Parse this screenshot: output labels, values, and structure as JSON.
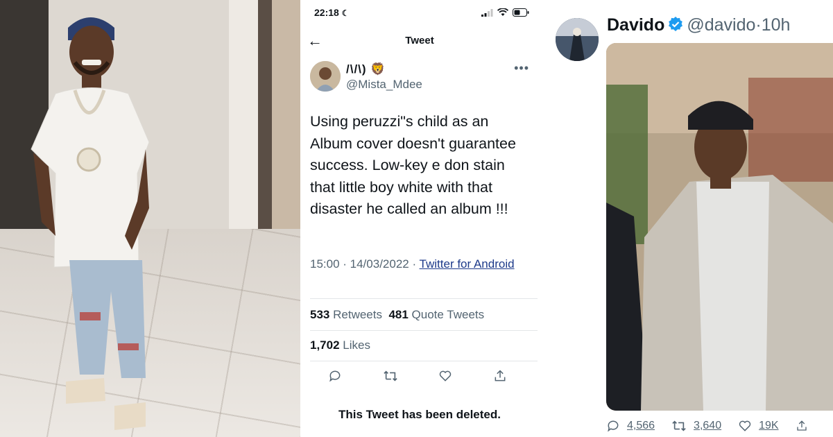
{
  "tweet_screen": {
    "status_bar": {
      "time": "22:18"
    },
    "header": {
      "title": "Tweet"
    },
    "author": {
      "name": "/\\/\\) 🦁",
      "handle": "@Mista_Mdee"
    },
    "body": "Using peruzzi\"s child as an Album cover doesn't guarantee success. Low-key e don stain that little boy white with that disaster he called an album !!!",
    "meta": {
      "time_date": "15:00 · 14/03/2022 · ",
      "source": "Twitter for Android"
    },
    "stats": {
      "retweets_count": "533",
      "retweets_label": "Retweets",
      "quotes_count": "481",
      "quotes_label": "Quote Tweets",
      "likes_count": "1,702",
      "likes_label": "Likes"
    },
    "deleted_notice": "This Tweet has been deleted."
  },
  "reply_tweet": {
    "name": "Davido",
    "handle": "@davido",
    "separator": "·",
    "age": "10h",
    "replies": "4,566",
    "retweets": "3,640",
    "likes": "19K"
  },
  "colors": {
    "verified": "#1d9bf0",
    "link": "#1d3a8a",
    "muted": "#536471"
  },
  "icons": [
    "back-arrow-icon",
    "more-icon",
    "reply-icon",
    "retweet-icon",
    "like-icon",
    "share-icon",
    "verified-icon",
    "signal-icon",
    "wifi-icon",
    "battery-icon",
    "moon-icon"
  ]
}
